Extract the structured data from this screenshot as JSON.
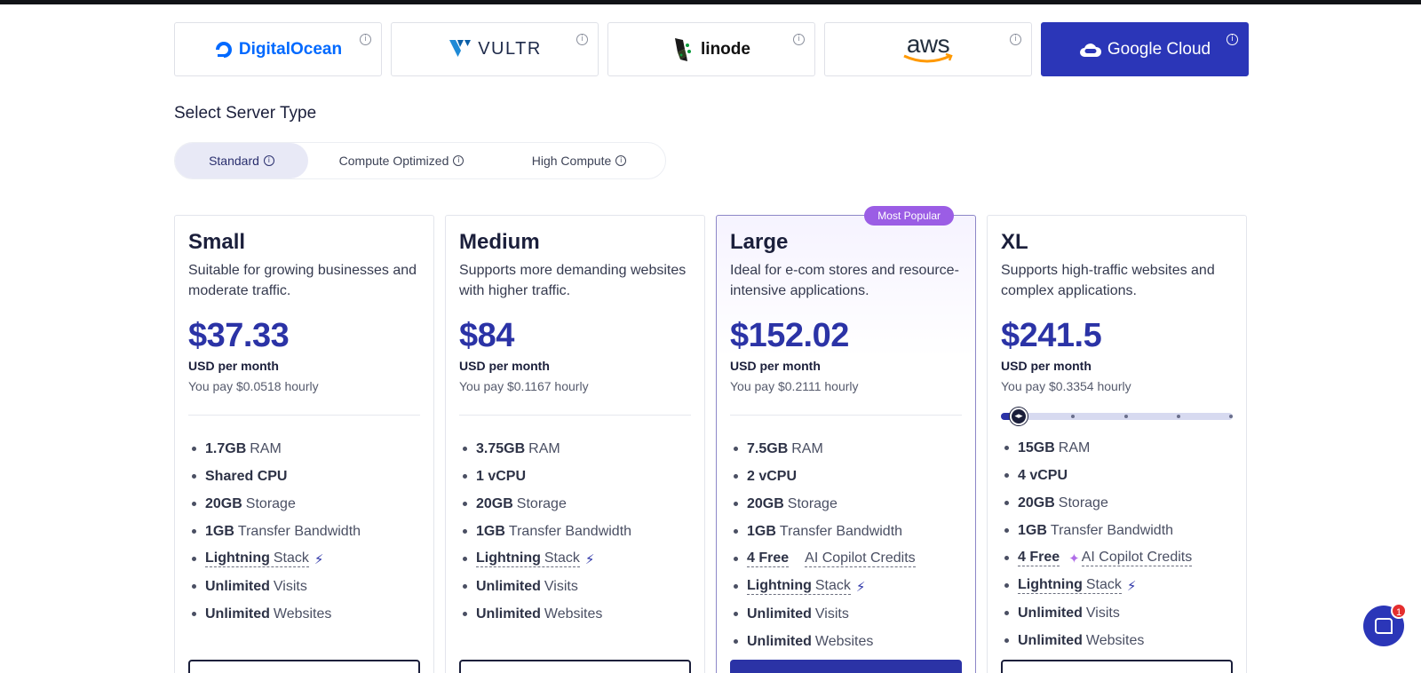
{
  "providers": [
    {
      "name": "DigitalOcean",
      "active": false
    },
    {
      "name": "VULTR",
      "active": false
    },
    {
      "name": "linode",
      "active": false
    },
    {
      "name": "aws",
      "active": false
    },
    {
      "name": "Google Cloud",
      "active": true
    }
  ],
  "info_glyph": "i",
  "server_type": {
    "title": "Select Server Type",
    "tabs": [
      {
        "label": "Standard",
        "active": true
      },
      {
        "label": "Compute Optimized",
        "active": false
      },
      {
        "label": "High Compute",
        "active": false
      }
    ]
  },
  "plans": [
    {
      "name": "Small",
      "description": "Suitable for growing businesses and moderate traffic.",
      "price": "$37.33",
      "period": "USD per month",
      "hourly": "You pay $0.0518 hourly",
      "features": [
        {
          "bold": "1.7GB",
          "text": "RAM"
        },
        {
          "bold": "Shared CPU",
          "text": ""
        },
        {
          "bold": "20GB",
          "text": "Storage"
        },
        {
          "bold": "1GB",
          "text": "Transfer Bandwidth"
        },
        {
          "lightning": "Lightning",
          "text": "Stack"
        },
        {
          "bold": "Unlimited",
          "text": "Visits"
        },
        {
          "bold": "Unlimited",
          "text": "Websites"
        }
      ]
    },
    {
      "name": "Medium",
      "description": "Supports more demanding websites with higher traffic.",
      "price": "$84",
      "period": "USD per month",
      "hourly": "You pay $0.1167 hourly",
      "features": [
        {
          "bold": "3.75GB",
          "text": "RAM"
        },
        {
          "bold": "1 vCPU",
          "text": ""
        },
        {
          "bold": "20GB",
          "text": "Storage"
        },
        {
          "bold": "1GB",
          "text": "Transfer Bandwidth"
        },
        {
          "lightning": "Lightning",
          "text": "Stack"
        },
        {
          "bold": "Unlimited",
          "text": "Visits"
        },
        {
          "bold": "Unlimited",
          "text": "Websites"
        }
      ]
    },
    {
      "name": "Large",
      "badge": "Most Popular",
      "description": "Ideal for e-com stores and resource-intensive applications.",
      "price": "$152.02",
      "period": "USD per month",
      "hourly": "You pay $0.2111 hourly",
      "features": [
        {
          "bold": "7.5GB",
          "text": "RAM"
        },
        {
          "bold": "2 vCPU",
          "text": ""
        },
        {
          "bold": "20GB",
          "text": "Storage"
        },
        {
          "bold": "1GB",
          "text": "Transfer Bandwidth"
        },
        {
          "credits": "4 Free",
          "text": "AI Copilot Credits"
        },
        {
          "lightning": "Lightning",
          "text": "Stack"
        },
        {
          "bold": "Unlimited",
          "text": "Visits"
        },
        {
          "bold": "Unlimited",
          "text": "Websites"
        }
      ]
    },
    {
      "name": "XL",
      "description": "Supports high-traffic websites and complex applications.",
      "price": "$241.5",
      "period": "USD per month",
      "hourly": "You pay $0.3354 hourly",
      "slider_level": 0,
      "slider_steps": 5,
      "features": [
        {
          "bold": "15GB",
          "text": "RAM"
        },
        {
          "bold": "4 vCPU",
          "text": ""
        },
        {
          "bold": "20GB",
          "text": "Storage"
        },
        {
          "bold": "1GB",
          "text": "Transfer Bandwidth"
        },
        {
          "credits": "4 Free",
          "text": "AI Copilot Credits"
        },
        {
          "lightning": "Lightning",
          "text": "Stack"
        },
        {
          "bold": "Unlimited",
          "text": "Visits"
        },
        {
          "bold": "Unlimited",
          "text": "Websites"
        }
      ]
    }
  ],
  "chat": {
    "unread_count": "1"
  },
  "colors": {
    "accent": "#2b33a6",
    "badge": "#9b5de5",
    "google_active": "#2b36b8"
  }
}
